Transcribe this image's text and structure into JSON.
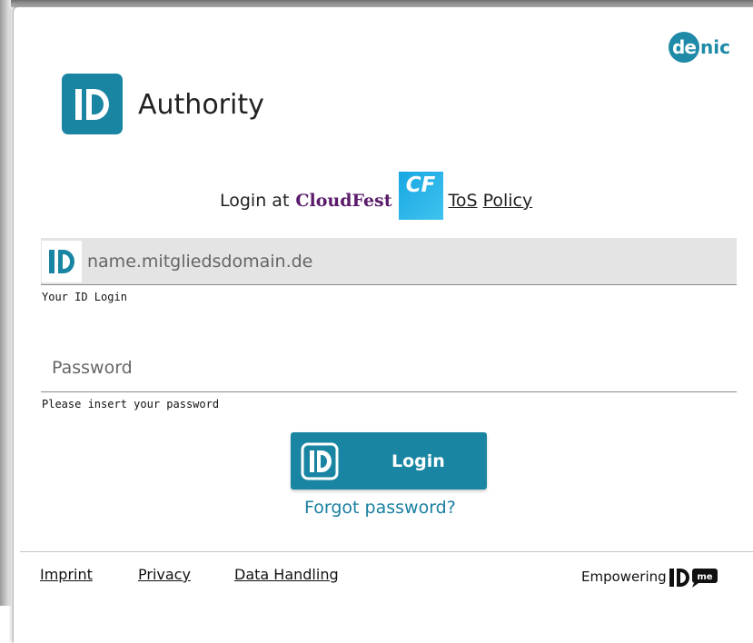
{
  "brand": {
    "logo_text": "ID",
    "title": "Authority"
  },
  "partner": {
    "name_part1": "de",
    "name_part2": "nic",
    "color": "#1f8aa7"
  },
  "login_line": {
    "prefix": "Login at",
    "event_name": "CloudFest",
    "event_logo_text": "CF",
    "tos_label": "ToS",
    "policy_label": "Policy"
  },
  "username": {
    "icon": "id-icon",
    "placeholder": "name.mitgliedsdomain.de",
    "value": "",
    "helper": "Your ID Login"
  },
  "password": {
    "placeholder": "Password",
    "value": "",
    "helper": "Please insert your password"
  },
  "login_button": {
    "icon": "id-icon",
    "label": "Login"
  },
  "forgot_label": "Forgot password?",
  "footer": {
    "links": [
      "Imprint",
      "Privacy",
      "Data Handling"
    ],
    "empowering_label": "Empowering",
    "empowering_logo_badge": "me"
  },
  "colors": {
    "accent": "#1a85a2",
    "event_name": "#5b1b6b",
    "event_logo": "#19a7e3",
    "field_background": "#e4e4e4"
  }
}
